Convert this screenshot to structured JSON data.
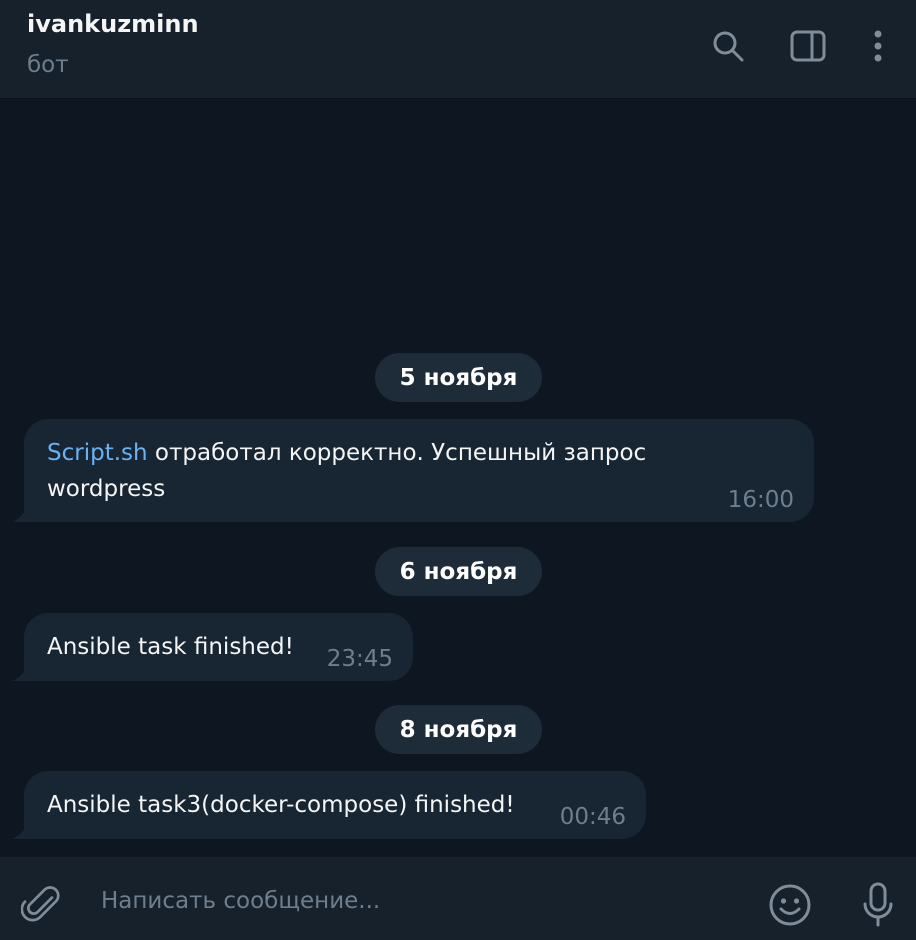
{
  "header": {
    "title": "ivankuzminn",
    "subtitle": "бот",
    "icons": [
      "search-icon",
      "sidebar-toggle-icon",
      "more-vertical-icon"
    ]
  },
  "messages": [
    {
      "date": "5 ноября",
      "link": "Script.sh",
      "text_line1": " отработал корректно. Успешный запрос",
      "text_line2": "wordpress",
      "time": "16:00"
    },
    {
      "date": "6 ноября",
      "text": "Ansible task finished!",
      "time": "23:45"
    },
    {
      "date": "8 ноября",
      "text": "Ansible task3(docker-compose) finished!",
      "time": "00:46"
    }
  ],
  "composer": {
    "placeholder": "Написать сообщение...",
    "icons": [
      "attach-icon",
      "emoji-icon",
      "microphone-icon"
    ]
  },
  "colors": {
    "background": "#0e1621",
    "panel": "#17212b",
    "bubble": "#182533",
    "date_pill": "#1e2c3a",
    "link": "#6ab3f3",
    "muted": "#6d7f8f"
  }
}
